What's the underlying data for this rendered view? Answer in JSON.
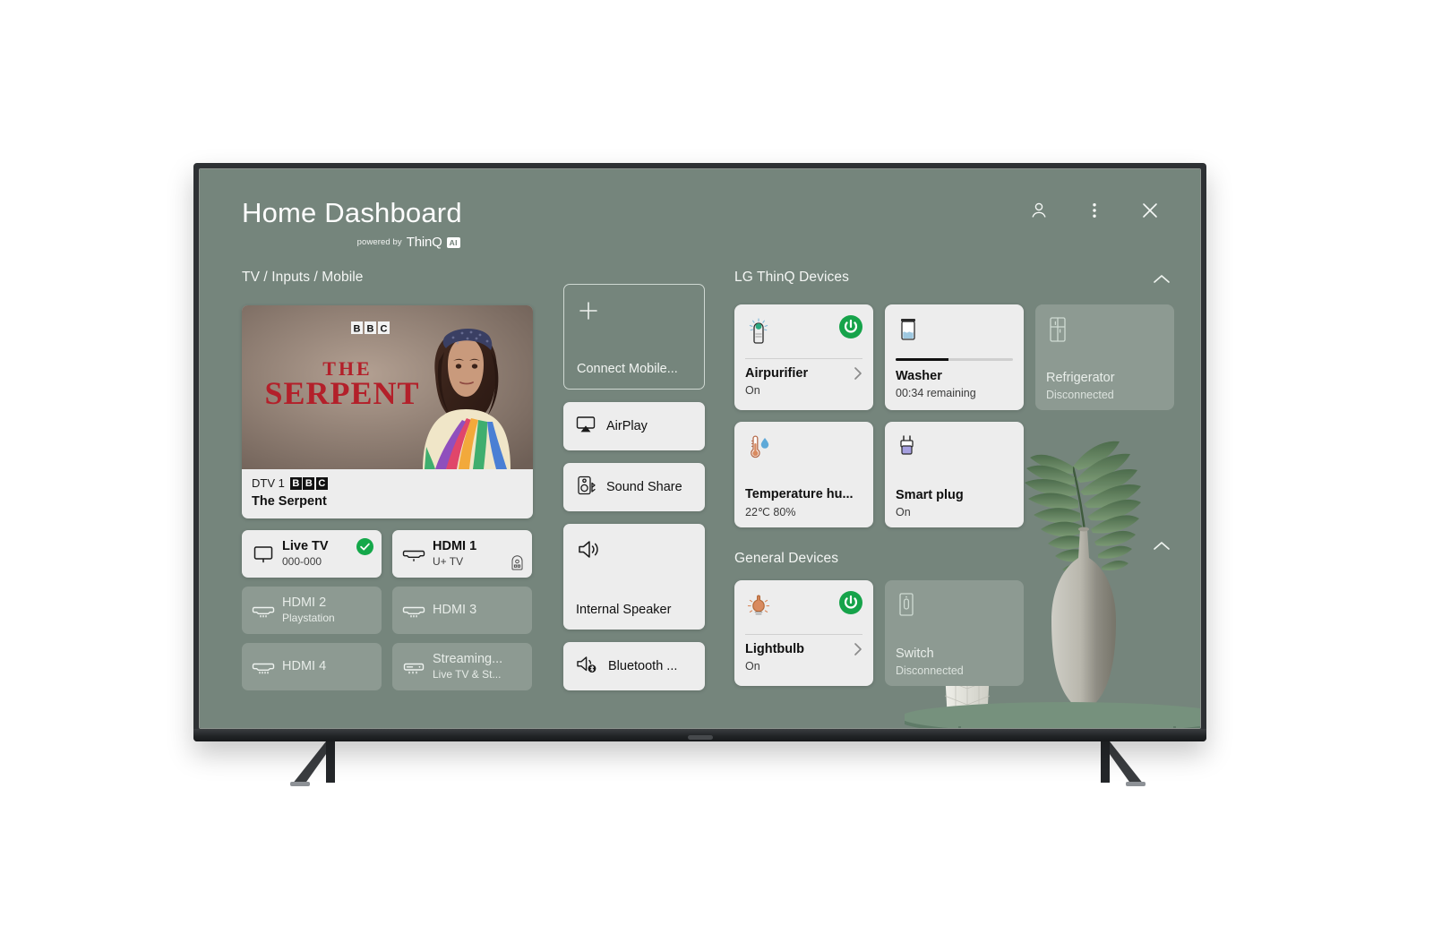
{
  "header": {
    "title": "Home Dashboard",
    "powered_by": "powered by",
    "thinq_wordmark": "ThinQ",
    "thinq_ai_badge": "AI",
    "actions": [
      {
        "name": "account-icon",
        "label": "Account"
      },
      {
        "name": "more-options-icon",
        "label": "More options"
      },
      {
        "name": "close-icon",
        "label": "Close"
      }
    ]
  },
  "sections": {
    "inputs_title": "TV / Inputs / Mobile",
    "thinq_title": "LG ThinQ Devices",
    "general_title": "General Devices"
  },
  "preview": {
    "channel": "DTV 1",
    "broadcaster_blocks": [
      "B",
      "B",
      "C"
    ],
    "program": "The Serpent",
    "art_title_line1": "THE",
    "art_title_line2": "SERPENT",
    "art_logo_blocks": [
      "B",
      "B",
      "C"
    ]
  },
  "inputs": [
    {
      "name": "input-live-tv",
      "title": "Live TV",
      "subtitle": "000-000",
      "icon": "tv-icon",
      "state": "active",
      "checked": true,
      "stb_badge": false
    },
    {
      "name": "input-hdmi-1",
      "title": "HDMI 1",
      "subtitle": "U+ TV",
      "icon": "hdmi-icon",
      "state": "active",
      "checked": false,
      "stb_badge": true
    },
    {
      "name": "input-hdmi-2",
      "title": "HDMI 2",
      "subtitle": "Playstation",
      "icon": "hdmi-icon",
      "state": "dim",
      "checked": false,
      "stb_badge": false
    },
    {
      "name": "input-hdmi-3",
      "title": "HDMI 3",
      "subtitle": "",
      "icon": "hdmi-icon",
      "state": "dim",
      "checked": false,
      "stb_badge": false
    },
    {
      "name": "input-hdmi-4",
      "title": "HDMI 4",
      "subtitle": "",
      "icon": "hdmi-icon",
      "state": "dim",
      "checked": false,
      "stb_badge": false
    },
    {
      "name": "input-streaming",
      "title": "Streaming...",
      "subtitle": "Live TV & St...",
      "icon": "streambox-icon",
      "state": "dim",
      "checked": false,
      "stb_badge": false
    }
  ],
  "mobile_column": [
    {
      "name": "connect-mobile-button",
      "label": "Connect Mobile...",
      "icon": "plus-icon",
      "style": "ghost-tall"
    },
    {
      "name": "airplay-button",
      "label": "AirPlay",
      "icon": "airplay-icon",
      "style": "short"
    },
    {
      "name": "sound-share-button",
      "label": "Sound Share",
      "icon": "soundshare-icon",
      "style": "short"
    },
    {
      "name": "internal-speaker-button",
      "label": "Internal Speaker",
      "icon": "speaker-icon",
      "style": "tall"
    },
    {
      "name": "bluetooth-button",
      "label": "Bluetooth ...",
      "icon": "bluetooth-speaker-icon",
      "style": "short"
    }
  ],
  "thinq_devices": [
    {
      "name": "device-airpurifier",
      "title": "Airpurifier",
      "status": "On",
      "icon": "airpurifier-icon",
      "state": "on",
      "power": true,
      "chevron": true,
      "divider": true,
      "progress": null
    },
    {
      "name": "device-washer",
      "title": "Washer",
      "status": "00:34 remaining",
      "icon": "washer-icon",
      "state": "on",
      "power": false,
      "chevron": false,
      "divider": false,
      "progress": 45
    },
    {
      "name": "device-refrigerator",
      "title": "Refrigerator",
      "status": "Disconnected",
      "icon": "refrigerator-icon",
      "state": "off",
      "power": false,
      "chevron": false,
      "divider": false,
      "progress": null
    },
    {
      "name": "device-temperature-humidity",
      "title": "Temperature hu...",
      "status": "22℃ 80%",
      "icon": "thermometer-icon",
      "state": "on",
      "power": false,
      "chevron": false,
      "divider": false,
      "progress": null
    },
    {
      "name": "device-smart-plug",
      "title": "Smart plug",
      "status": "On",
      "icon": "smartplug-icon",
      "state": "on",
      "power": false,
      "chevron": false,
      "divider": false,
      "progress": null
    }
  ],
  "general_devices": [
    {
      "name": "device-lightbulb",
      "title": "Lightbulb",
      "status": "On",
      "icon": "lightbulb-icon",
      "state": "on",
      "power": true,
      "chevron": true,
      "divider": true,
      "progress": null
    },
    {
      "name": "device-switch",
      "title": "Switch",
      "status": "Disconnected",
      "icon": "switch-icon",
      "state": "off",
      "power": false,
      "chevron": false,
      "divider": false,
      "progress": null
    }
  ],
  "colors": {
    "screen_bg": "#75857c",
    "card_bg": "#ededed",
    "card_dim_bg": "#8d9a92",
    "power_on_green": "#16a34a",
    "check_green": "#14a84a",
    "text_dark": "#101010",
    "text_light": "#f4f6f4",
    "bezel": "#2e3134"
  }
}
